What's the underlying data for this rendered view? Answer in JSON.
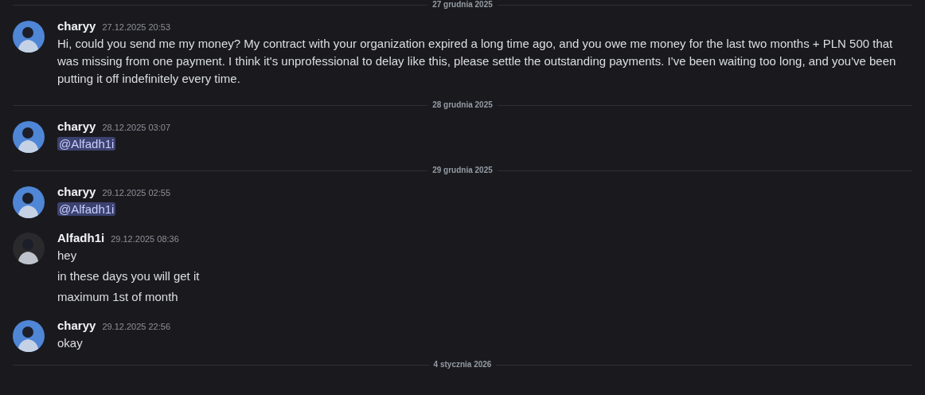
{
  "messages": [
    {
      "kind": "divider",
      "label": "27 grudnia 2025"
    },
    {
      "kind": "message",
      "author": "charyy",
      "timestamp": "27.12.2025 20:53",
      "color": "#4f86d6",
      "lines": [
        {
          "kind": "plain",
          "text": "Hi, could you send me my money? My contract with your organization expired a long time ago, and you owe me money for the last two months + PLN 500 that was missing from one payment. I think it's unprofessional to delay like this, please settle the outstanding payments. I've been waiting too long, and you've been putting it off indefinitely every time."
        }
      ]
    },
    {
      "kind": "divider",
      "label": "28 grudnia 2025"
    },
    {
      "kind": "message",
      "author": "charyy",
      "timestamp": "28.12.2025 03:07",
      "color": "#4f86d6",
      "lines": [
        {
          "kind": "mention",
          "text": "@Alfadh1i"
        }
      ]
    },
    {
      "kind": "divider",
      "label": "29 grudnia 2025"
    },
    {
      "kind": "message",
      "author": "charyy",
      "timestamp": "29.12.2025 02:55",
      "color": "#4f86d6",
      "lines": [
        {
          "kind": "mention",
          "text": "@Alfadh1i"
        }
      ]
    },
    {
      "kind": "message",
      "author": "Alfadh1i",
      "timestamp": "29.12.2025 08:36",
      "color": "#2a2a2c",
      "lines": [
        {
          "kind": "plain",
          "text": "hey"
        },
        {
          "kind": "plain",
          "text": "in these days you will get it"
        },
        {
          "kind": "plain",
          "text": "maximum 1st of month"
        }
      ]
    },
    {
      "kind": "message",
      "author": "charyy",
      "timestamp": "29.12.2025 22:56",
      "color": "#4f86d6",
      "lines": [
        {
          "kind": "plain",
          "text": "okay"
        }
      ]
    },
    {
      "kind": "divider",
      "label": "4 stycznia 2026"
    }
  ]
}
